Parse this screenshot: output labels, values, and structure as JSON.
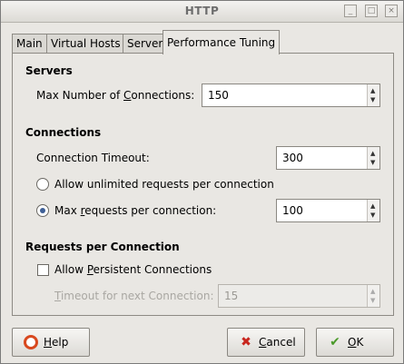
{
  "window": {
    "title": "HTTP"
  },
  "titlebar_buttons": {
    "minimize_glyph": "_",
    "maximize_glyph": "□",
    "close_glyph": "×"
  },
  "tabs": [
    {
      "label": "Main"
    },
    {
      "label": "Virtual Hosts"
    },
    {
      "label": "Server"
    },
    {
      "label": "Performance Tuning",
      "active": true
    }
  ],
  "servers": {
    "heading": "Servers",
    "max_connections": {
      "label_pre": "Max Number of ",
      "label_u": "C",
      "label_post": "onnections:",
      "value": "150"
    }
  },
  "connections": {
    "heading": "Connections",
    "timeout": {
      "label": "Connection Timeout:",
      "value": "300"
    },
    "unlimited": {
      "label": "Allow unlimited requests per connection",
      "selected": false
    },
    "max_requests": {
      "label_pre": "Max ",
      "label_u": "r",
      "label_post": "equests per connection:",
      "selected": true,
      "value": "100"
    }
  },
  "requests_per_connection": {
    "heading": "Requests per Connection",
    "persistent": {
      "label_pre": "Allow ",
      "label_u": "P",
      "label_post": "ersistent Connections",
      "checked": false
    },
    "next_timeout": {
      "label_pre": "",
      "label_u": "T",
      "label_post": "imeout for next Connection:",
      "value": "15",
      "disabled": true
    }
  },
  "buttons": {
    "help": {
      "label_u": "H",
      "label_post": "elp"
    },
    "cancel": {
      "label_u": "C",
      "label_post": "ancel"
    },
    "ok": {
      "label_u": "O",
      "label_post": "K"
    }
  },
  "colors": {
    "accent": "#3e5f96",
    "background": "#e9e7e3"
  }
}
